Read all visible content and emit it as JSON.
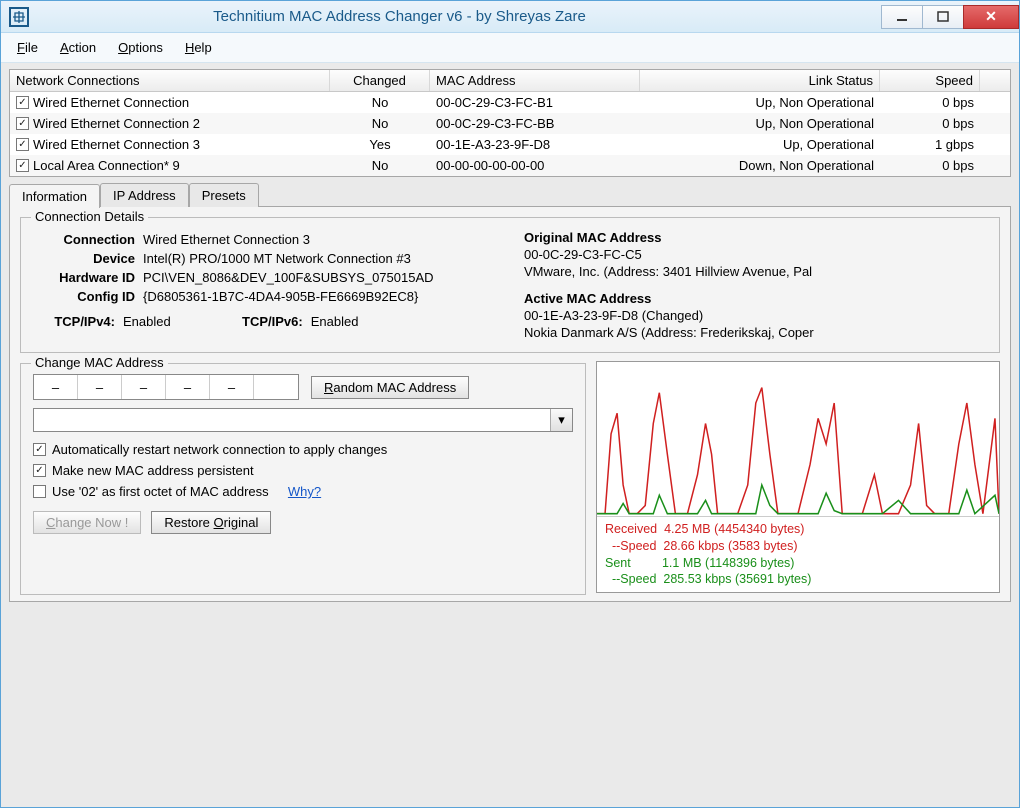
{
  "title": "Technitium MAC Address Changer v6 - by Shreyas Zare",
  "menu": {
    "file": "File",
    "action": "Action",
    "options": "Options",
    "help": "Help"
  },
  "grid": {
    "headers": {
      "name": "Network Connections",
      "changed": "Changed",
      "mac": "MAC Address",
      "link": "Link Status",
      "speed": "Speed"
    },
    "rows": [
      {
        "checked": true,
        "name": "Wired Ethernet Connection",
        "changed": "No",
        "mac": "00-0C-29-C3-FC-B1",
        "link": "Up, Non Operational",
        "speed": "0 bps"
      },
      {
        "checked": true,
        "name": "Wired Ethernet Connection 2",
        "changed": "No",
        "mac": "00-0C-29-C3-FC-BB",
        "link": "Up, Non Operational",
        "speed": "0 bps"
      },
      {
        "checked": true,
        "name": "Wired Ethernet Connection 3",
        "changed": "Yes",
        "mac": "00-1E-A3-23-9F-D8",
        "link": "Up, Operational",
        "speed": "1 gbps"
      },
      {
        "checked": true,
        "name": "Local Area Connection* 9",
        "changed": "No",
        "mac": "00-00-00-00-00-00",
        "link": "Down, Non Operational",
        "speed": "0 bps"
      }
    ]
  },
  "tabs": {
    "info": "Information",
    "ip": "IP Address",
    "presets": "Presets"
  },
  "details": {
    "legend": "Connection Details",
    "connection_label": "Connection",
    "connection": "Wired Ethernet Connection 3",
    "device_label": "Device",
    "device": "Intel(R) PRO/1000 MT Network Connection #3",
    "hwid_label": "Hardware ID",
    "hwid": "PCI\\VEN_8086&DEV_100F&SUBSYS_075015AD",
    "cfgid_label": "Config ID",
    "cfgid": "{D6805361-1B7C-4DA4-905B-FE6669B92EC8}",
    "tcpv4_label": "TCP/IPv4:",
    "tcpv4": "Enabled",
    "tcpv6_label": "TCP/IPv6:",
    "tcpv6": "Enabled",
    "orig_hdr": "Original MAC Address",
    "orig_mac": "00-0C-29-C3-FC-C5",
    "orig_vendor": "VMware, Inc.  (Address: 3401 Hillview Avenue, Pal",
    "active_hdr": "Active MAC Address",
    "active_mac": "00-1E-A3-23-9F-D8 (Changed)",
    "active_vendor": "Nokia Danmark A/S (Address: Frederikskaj, Coper"
  },
  "change": {
    "legend": "Change MAC Address",
    "seg": "–",
    "random_btn": "Random MAC Address",
    "opt_restart": "Automatically restart network connection to apply changes",
    "opt_persist": "Make new MAC address persistent",
    "opt_02": "Use '02' as first octet of MAC address",
    "why": "Why?",
    "change_btn": "Change Now !",
    "restore_btn": "Restore Original"
  },
  "stats": {
    "recv_label": "Received",
    "recv_val": "4.25 MB (4454340 bytes)",
    "recv_spd_label": "--Speed",
    "recv_spd": "28.66 kbps (3583 bytes)",
    "sent_label": "Sent",
    "sent_val": "1.1 MB (1148396 bytes)",
    "sent_spd_label": "--Speed",
    "sent_spd": "285.53 kbps (35691 bytes)"
  }
}
